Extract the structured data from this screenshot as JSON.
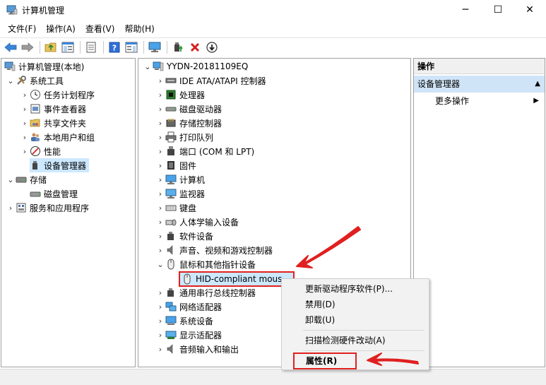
{
  "window": {
    "title": "计算机管理",
    "minimize_glyph": "─",
    "maximize_glyph": "☐",
    "close_glyph": "✕"
  },
  "menu": [
    "文件(F)",
    "操作(A)",
    "查看(V)",
    "帮助(H)"
  ],
  "toolbar": {
    "buttons": [
      "back-arrow-icon",
      "forward-arrow-icon",
      "up-folder-icon",
      "show-hide-tree-icon",
      "export-list-icon",
      "help-icon",
      "show-hide-action-pane-icon",
      "monitor-icon",
      "update-driver-icon",
      "uninstall-x-icon",
      "download-arrow-icon"
    ]
  },
  "left_tree": {
    "root": "计算机管理(本地)",
    "system_tools": "系统工具",
    "task_scheduler": "任务计划程序",
    "event_viewer": "事件查看器",
    "shared_folders": "共享文件夹",
    "local_users": "本地用户和组",
    "performance": "性能",
    "device_manager": "设备管理器",
    "storage": "存储",
    "disk_management": "磁盘管理",
    "services": "服务和应用程序"
  },
  "device_tree": {
    "computer_name": "YYDN-20181109EQ",
    "categories": [
      "IDE ATA/ATAPI 控制器",
      "处理器",
      "磁盘驱动器",
      "存储控制器",
      "打印队列",
      "端口 (COM 和 LPT)",
      "固件",
      "计算机",
      "监视器",
      "键盘",
      "人体学输入设备",
      "软件设备",
      "声音、视频和游戏控制器",
      "鼠标和其他指针设备"
    ],
    "selected_device": "HID-compliant mous~",
    "after_categories": [
      "通用串行总线控制器",
      "网络适配器",
      "系统设备",
      "显示适配器",
      "音频输入和输出"
    ]
  },
  "actions": {
    "header": "操作",
    "section": "设备管理器",
    "more": "更多操作"
  },
  "context_menu": {
    "update_driver": "更新驱动程序软件(P)...",
    "disable": "禁用(D)",
    "uninstall": "卸载(U)",
    "scan": "扫描检测硬件改动(A)",
    "properties": "属性(R)"
  },
  "colors": {
    "selection": "#cce8ff",
    "annotation_red": "#e02020",
    "action_section": "#cfe4f7"
  }
}
